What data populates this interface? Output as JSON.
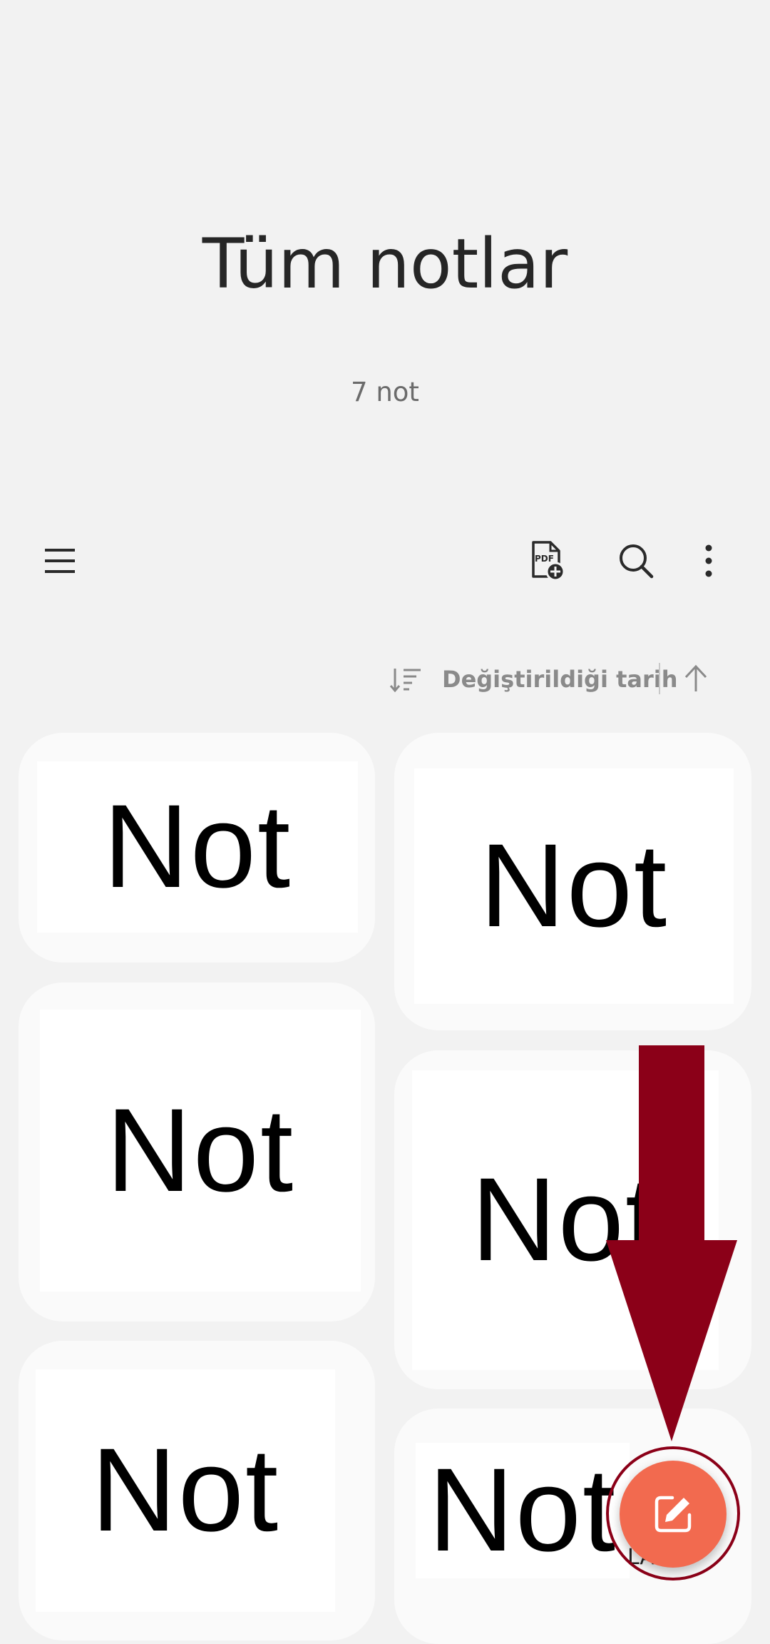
{
  "header": {
    "title": "Tüm notlar",
    "count": "7 not"
  },
  "toolbar": {
    "menu_icon": "hamburger-menu-icon",
    "pdf_icon": "pdf-add-icon",
    "search_icon": "search-icon",
    "more_icon": "more-vertical-icon"
  },
  "sort": {
    "label": "Değiştirildiği tarih",
    "sort_icon": "sort-lines-icon",
    "direction_icon": "arrow-up-icon"
  },
  "notes": [
    {
      "text": "Not"
    },
    {
      "text": "Not"
    },
    {
      "text": "Not"
    },
    {
      "text": "Not"
    },
    {
      "text": "Not"
    },
    {
      "text": "Not"
    }
  ],
  "partial_label": "LAW",
  "fab": {
    "icon": "compose-note-icon",
    "accent": "#f26a4f"
  },
  "annotation": {
    "color": "#8b0018",
    "icon": "down-arrow-overlay"
  }
}
